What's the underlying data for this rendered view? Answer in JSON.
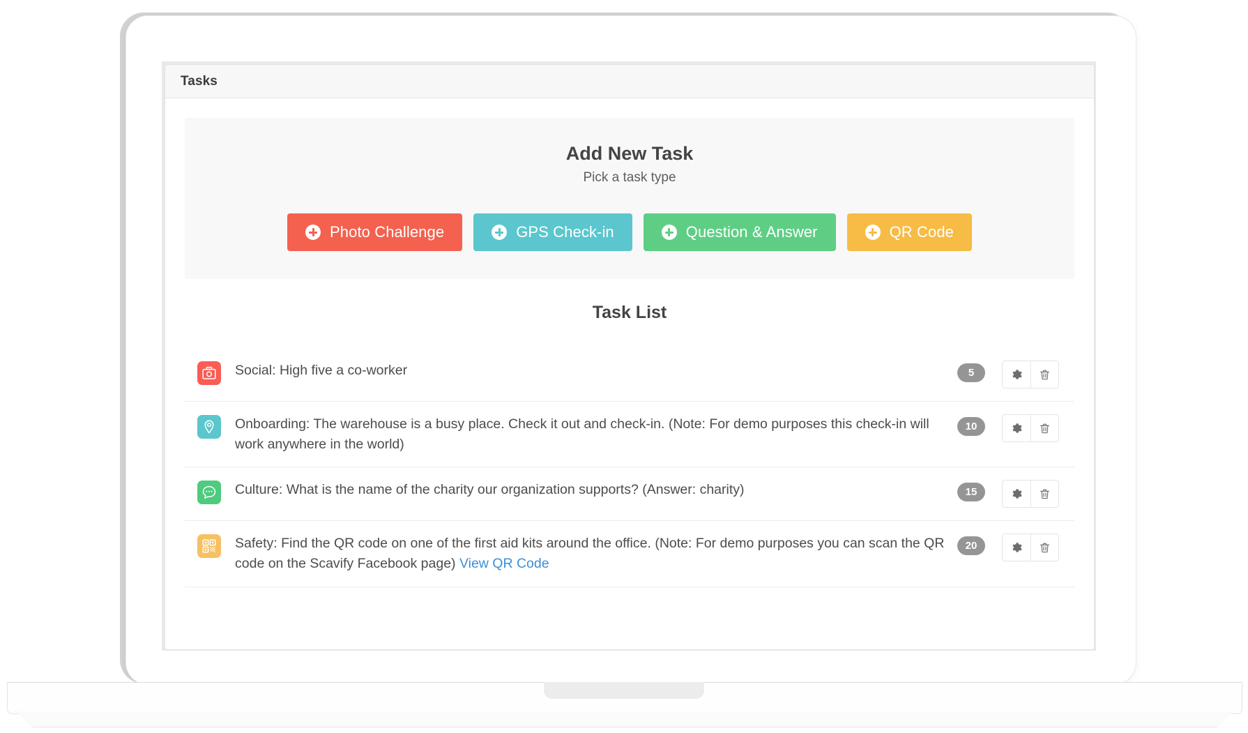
{
  "window": {
    "panel_title": "Tasks"
  },
  "add_new": {
    "title": "Add New Task",
    "subtitle": "Pick a task type",
    "buttons": [
      {
        "label": "Photo Challenge",
        "color": "#f4614f",
        "icon": "plus-circle-icon"
      },
      {
        "label": "GPS Check-in",
        "color": "#5bc6cd",
        "icon": "plus-circle-icon"
      },
      {
        "label": "Question & Answer",
        "color": "#5fce85",
        "icon": "plus-circle-icon"
      },
      {
        "label": "QR Code",
        "color": "#f7bc46",
        "icon": "plus-circle-icon"
      }
    ]
  },
  "task_list": {
    "title": "Task List",
    "settings_label": "Settings",
    "delete_label": "Delete",
    "rows": [
      {
        "icon": "camera-icon",
        "icon_color": "#f95d54",
        "text": "Social: High five a co-worker",
        "link_text": "",
        "points": "5"
      },
      {
        "icon": "map-pin-icon",
        "icon_color": "#5bc6cd",
        "text": "Onboarding: The warehouse is a busy place. Check it out and check-in. (Note: For demo purposes this check-in will work anywhere in the world)",
        "link_text": "",
        "points": "10"
      },
      {
        "icon": "chat-bubble-icon",
        "icon_color": "#4ecb7d",
        "text": "Culture: What is the name of the charity our organization supports? (Answer: charity)",
        "link_text": "",
        "points": "15"
      },
      {
        "icon": "qr-code-icon",
        "icon_color": "#f7c061",
        "text": "Safety: Find the QR code on one of the first aid kits around the office. (Note: For demo purposes you can scan the QR code on the Scavify Facebook page) ",
        "link_text": "View QR Code",
        "points": "20"
      }
    ]
  }
}
